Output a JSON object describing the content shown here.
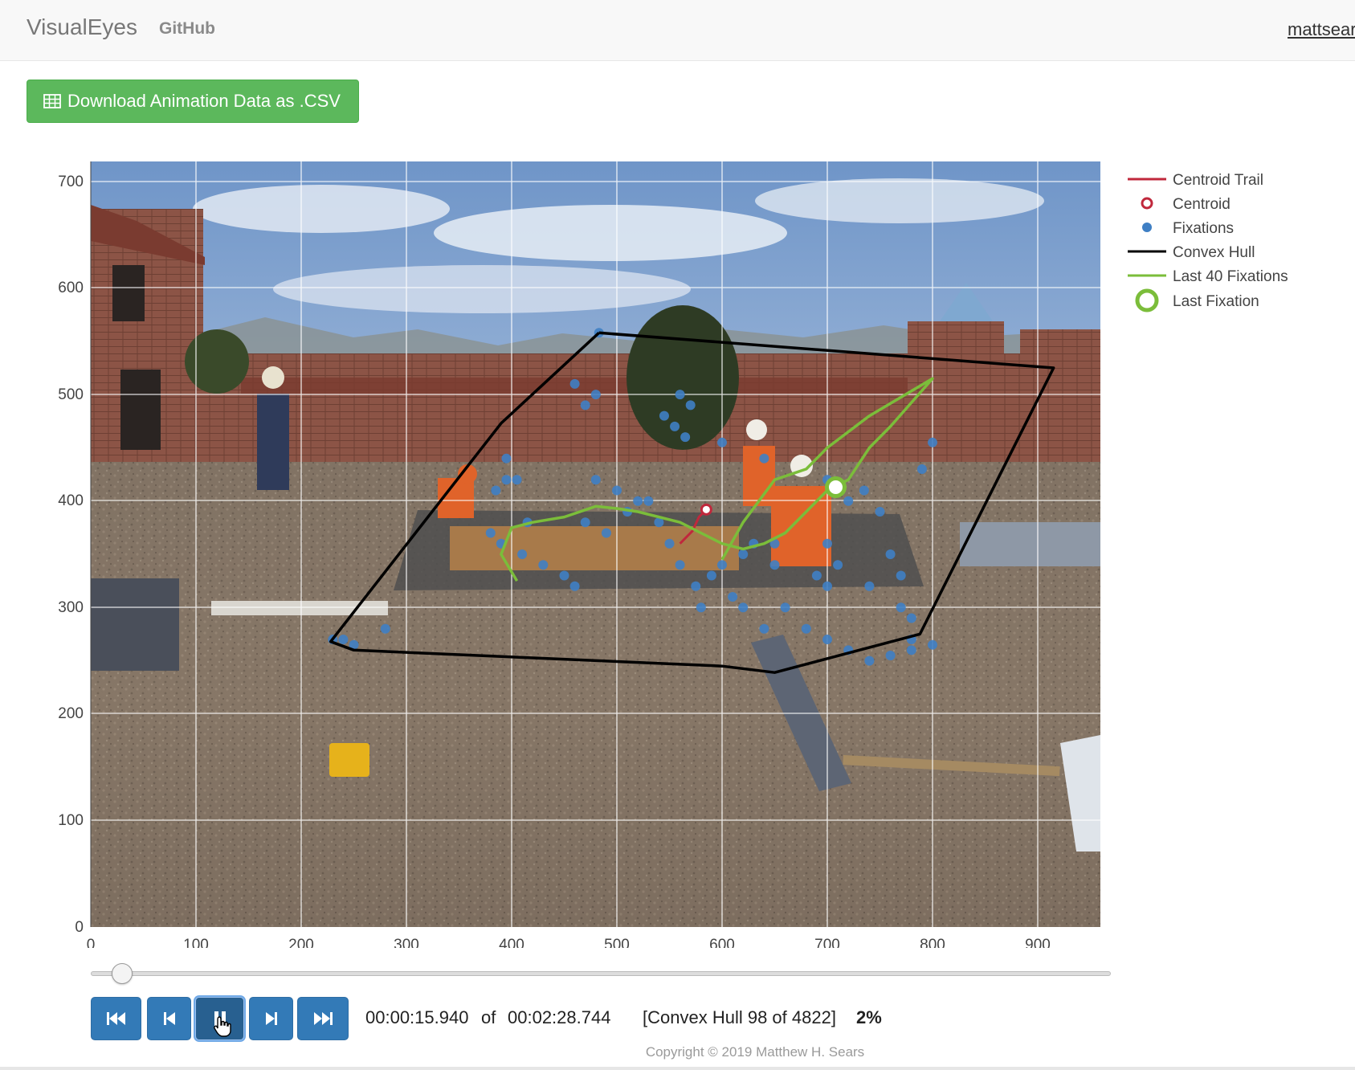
{
  "nav": {
    "brand": "VisualEyes",
    "github": "GitHub",
    "user": "mattsear"
  },
  "actions": {
    "download_label": "Download Animation Data as .CSV",
    "download_icon": "table-icon"
  },
  "plot": {
    "x_ticks": [
      "0",
      "100",
      "200",
      "300",
      "400",
      "500",
      "600",
      "700",
      "800",
      "900"
    ],
    "y_ticks": [
      "0",
      "100",
      "200",
      "300",
      "400",
      "500",
      "600",
      "700"
    ],
    "background": "rooftop construction photo with workers",
    "colors": {
      "centroid": "#c0283c",
      "fixations": "#3f7fc4",
      "hull": "#000000",
      "trail": "#7bbd3a"
    }
  },
  "legend": [
    "Centroid Trail",
    "Centroid",
    "Fixations",
    "Convex Hull",
    "Last 40 Fixations",
    "Last Fixation"
  ],
  "chart_data": {
    "type": "scatter",
    "xlim": [
      0,
      960
    ],
    "ylim": [
      0,
      720
    ],
    "x_ticks": [
      0,
      100,
      200,
      300,
      400,
      500,
      600,
      700,
      800,
      900
    ],
    "y_ticks": [
      0,
      100,
      200,
      300,
      400,
      500,
      600,
      700
    ],
    "grid": true,
    "legend_position": "right",
    "series": [
      {
        "name": "Convex Hull",
        "type": "line",
        "x": [
          483,
          915,
          788,
          650,
          600,
          250,
          228,
          390,
          483
        ],
        "y": [
          558,
          525,
          275,
          239,
          245,
          260,
          268,
          473,
          558
        ]
      },
      {
        "name": "Fixations",
        "type": "scatter",
        "x": [
          483,
          460,
          470,
          480,
          395,
          405,
          415,
          380,
          390,
          410,
          430,
          450,
          460,
          480,
          500,
          520,
          540,
          550,
          560,
          575,
          580,
          590,
          600,
          610,
          620,
          640,
          660,
          680,
          700,
          720,
          740,
          760,
          780,
          800,
          560,
          570,
          545,
          555,
          565,
          600,
          640,
          700,
          720,
          735,
          750,
          760,
          770,
          780,
          690,
          700,
          710,
          740,
          620,
          630,
          650,
          470,
          490,
          510,
          530,
          385,
          395,
          240,
          250,
          280,
          230,
          800,
          790,
          770,
          650,
          700,
          780
        ],
        "y": [
          558,
          510,
          490,
          500,
          440,
          420,
          380,
          370,
          360,
          350,
          340,
          330,
          320,
          420,
          410,
          400,
          380,
          360,
          340,
          320,
          300,
          330,
          340,
          310,
          300,
          280,
          300,
          280,
          270,
          260,
          250,
          255,
          260,
          265,
          500,
          490,
          480,
          470,
          460,
          455,
          440,
          420,
          400,
          410,
          390,
          350,
          300,
          270,
          330,
          360,
          340,
          320,
          350,
          360,
          340,
          380,
          370,
          390,
          400,
          410,
          420,
          270,
          265,
          280,
          270,
          455,
          430,
          330,
          360,
          320,
          290
        ]
      },
      {
        "name": "Centroid Trail",
        "type": "line",
        "x": [
          560,
          572,
          578,
          585
        ],
        "y": [
          360,
          372,
          385,
          392
        ]
      },
      {
        "name": "Centroid",
        "type": "marker",
        "x": [
          585
        ],
        "y": [
          392
        ]
      },
      {
        "name": "Last 40 Fixations",
        "type": "line",
        "x": [
          405,
          390,
          400,
          420,
          450,
          480,
          500,
          520,
          560,
          580,
          600,
          620,
          640,
          660,
          680,
          700,
          720,
          740,
          760,
          800,
          740,
          700,
          680,
          650,
          620,
          600
        ],
        "y": [
          325,
          350,
          375,
          380,
          385,
          395,
          393,
          390,
          380,
          370,
          360,
          355,
          360,
          370,
          390,
          410,
          420,
          450,
          470,
          515,
          480,
          450,
          430,
          420,
          380,
          345
        ]
      },
      {
        "name": "Last Fixation",
        "type": "marker",
        "x": [
          708
        ],
        "y": [
          413
        ]
      }
    ]
  },
  "playback": {
    "current_time": "00:00:15.940",
    "of_label": "of",
    "total_time": "00:02:28.744",
    "hull_status": "[Convex Hull 98 of 4822]",
    "percent": "2%",
    "progress_fraction": 0.02
  },
  "footer": {
    "copyright": "Copyright © 2019 Matthew H. Sears"
  }
}
